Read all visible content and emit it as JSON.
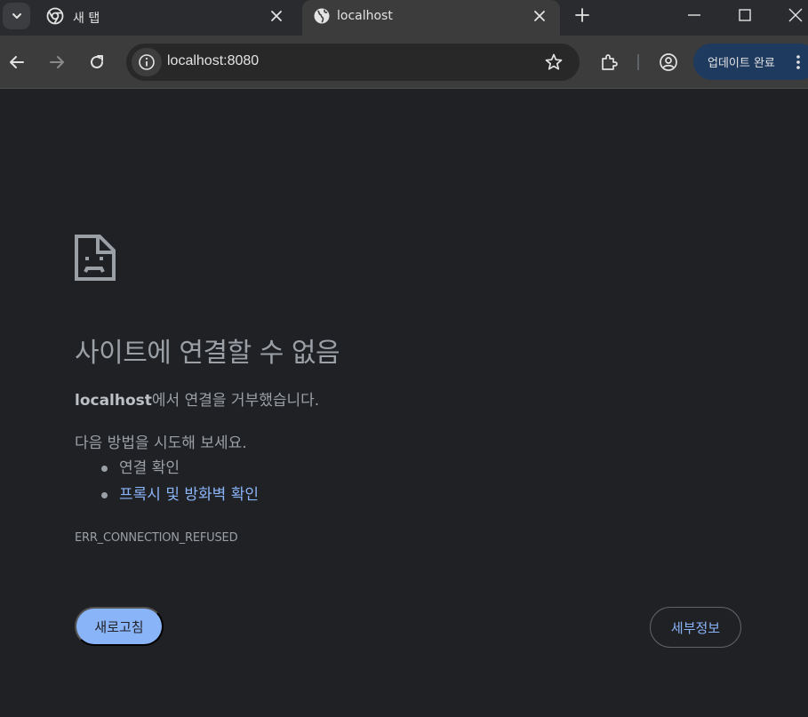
{
  "tabs": [
    {
      "title": "새 탭",
      "icon": "chrome-icon"
    },
    {
      "title": "localhost",
      "icon": "globe-icon"
    }
  ],
  "toolbar": {
    "url": "localhost:8080",
    "update_label": "업데이트 완료"
  },
  "error": {
    "heading": "사이트에 연결할 수 없음",
    "host": "localhost",
    "refused_suffix": "에서 연결을 거부했습니다.",
    "suggestion_intro": "다음 방법을 시도해 보세요.",
    "suggestions": [
      "연결 확인",
      "프록시 및 방화벽 확인"
    ],
    "code": "ERR_CONNECTION_REFUSED",
    "reload_label": "새로고침",
    "details_label": "세부정보"
  },
  "colors": {
    "background": "#202124",
    "accent": "#8ab4f8",
    "text": "#9aa0a6"
  }
}
